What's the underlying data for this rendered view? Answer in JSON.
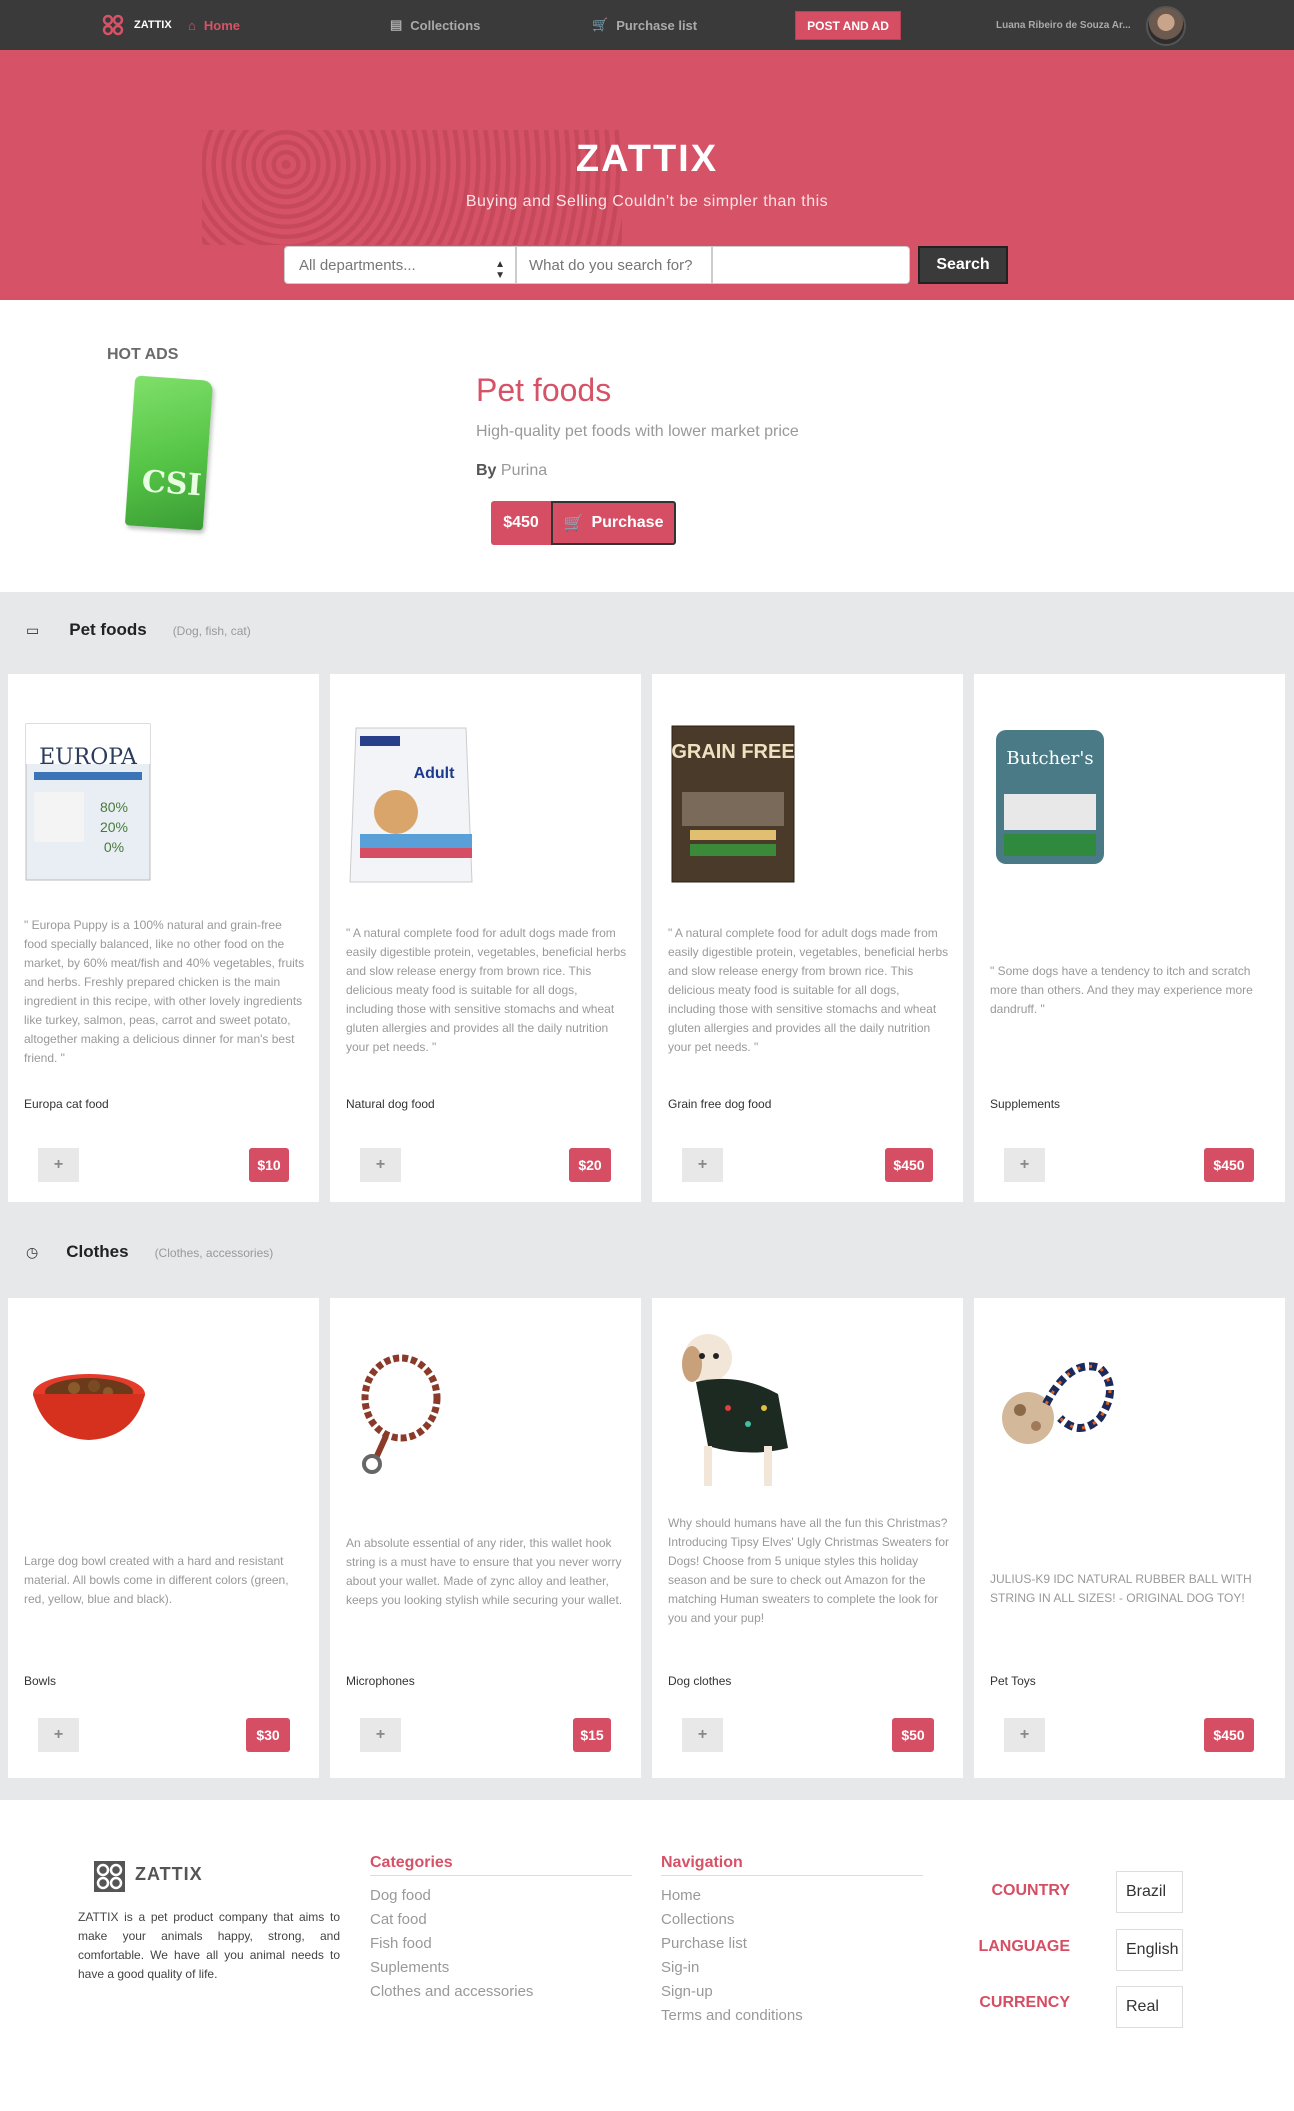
{
  "navbar": {
    "brand": "ZATTIX",
    "home": "Home",
    "collections": "Collections",
    "purchase_list": "Purchase list",
    "post_ad": "POST AND AD",
    "user_name": "Luana Ribeiro de Souza Ar...",
    "icons": {
      "brand": "logo-grid-icon",
      "home": "home-icon",
      "collections": "folder-icon",
      "purchase": "cart-icon"
    }
  },
  "hero": {
    "title": "ZATTIX",
    "subtitle": "Buying and Selling Couldn't be simpler than this",
    "department_select": "All departments...",
    "search_placeholder": "What do you search for?",
    "search_button": "Search"
  },
  "hot_ads": {
    "label": "HOT ADS",
    "image_text": "CSI",
    "title": "Pet foods",
    "subtitle": "High-quality pet foods with lower market price",
    "by_label": "By",
    "by_value": "Purina",
    "price": "$450",
    "purchase_button": "Purchase"
  },
  "sections": [
    {
      "icon": "laptop-icon",
      "title": "Pet foods",
      "subtitle": "(Dog, fish, cat)",
      "cards": [
        {
          "desc": "\" Europa Puppy is a 100% natural and grain-free food specially balanced, like no other food on the market, by 60% meat/fish and 40% vegetables, fruits and herbs. Freshly prepared chicken is the main ingredient in this recipe, with other lovely ingredients like turkey, salmon, peas, carrot and sweet potato, altogether making a delicious dinner for man's best friend. \"",
          "name": "Europa cat food",
          "price": "$10",
          "add": "+",
          "img_text": "EUROPA"
        },
        {
          "desc": "\" A natural complete food for adult dogs made from easily digestible protein, vegetables, beneficial herbs and slow release energy from brown rice. This delicious meaty food is suitable for all dogs, including those with sensitive stomachs and wheat gluten allergies and provides all the daily nutrition your pet needs. \"",
          "name": "Natural dog food",
          "price": "$20",
          "add": "+",
          "img_text": "Adult"
        },
        {
          "desc": "\" A natural complete food for adult dogs made from easily digestible protein, vegetables, beneficial herbs and slow release energy from brown rice. This delicious meaty food is suitable for all dogs, including those with sensitive stomachs and wheat gluten allergies and provides all the daily nutrition your pet needs. \"",
          "name": "Grain free dog food",
          "price": "$450",
          "add": "+",
          "img_text": "GRAIN FREE"
        },
        {
          "desc": "\" Some dogs have a tendency to itch and scratch more than others. And they may experience more dandruff. \"",
          "name": "Supplements",
          "price": "$450",
          "add": "+",
          "img_text": "Butcher's"
        }
      ]
    },
    {
      "icon": "clock-icon",
      "title": "Clothes",
      "subtitle": "(Clothes, accessories)",
      "cards": [
        {
          "desc": "Large dog bowl created with a hard and resistant material. All bowls come in different colors (green, red, yellow, blue and black).",
          "name": "Bowls",
          "price": "$30",
          "add": "+"
        },
        {
          "desc": "An absolute essential of any rider, this wallet hook string is a must have to ensure that you never worry about your wallet. Made of zync alloy and leather, keeps you looking stylish while securing your wallet.",
          "name": "Microphones",
          "price": "$15",
          "add": "+"
        },
        {
          "desc": "Why should humans have all the fun this Christmas? Introducing Tipsy Elves' Ugly Christmas Sweaters for Dogs! Choose from 5 unique styles this holiday season and be sure to check out Amazon for the matching Human sweaters to complete the look for you and your pup!",
          "name": "Dog clothes",
          "price": "$50",
          "add": "+"
        },
        {
          "desc": "JULIUS-K9 IDC NATURAL RUBBER BALL WITH STRING IN ALL SIZES! - ORIGINAL DOG TOY!",
          "name": "Pet Toys",
          "price": "$450",
          "add": "+"
        }
      ]
    }
  ],
  "footer": {
    "brand": "ZATTIX",
    "about": "ZATTIX is a pet product company that aims to make your animals happy, strong, and comfortable. We have all you animal needs to have a good quality of life.",
    "categories_title": "Categories",
    "categories": [
      "Dog food",
      "Cat food",
      "Fish food",
      "Suplements",
      "Clothes and accessories"
    ],
    "navigation_title": "Navigation",
    "navigation": [
      "Home",
      "Collections",
      "Purchase list",
      "Sig-in",
      "Sign-up",
      "Terms and conditions"
    ],
    "country_label": "COUNTRY",
    "country_value": "Brazil",
    "language_label": "LANGUAGE",
    "language_value": "English",
    "currency_label": "CURRENCY",
    "currency_value": "Real"
  },
  "colors": {
    "accent": "#d65267",
    "navbar": "#3a3a3a",
    "section_bg": "#e6e8ea"
  }
}
